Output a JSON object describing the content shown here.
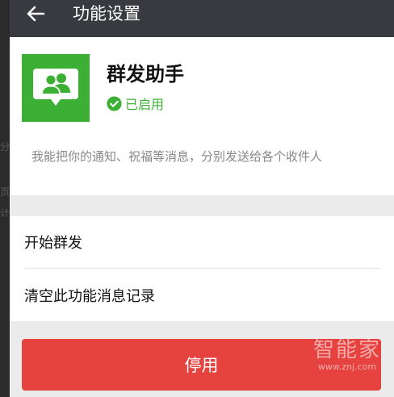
{
  "header": {
    "back_icon": "back-arrow-icon",
    "title": "功能设置"
  },
  "feature": {
    "icon": "group-people-chat-icon",
    "icon_color": "#3cb034",
    "name": "群发助手",
    "status_icon": "check-circle-icon",
    "status": "已启用",
    "description": "我能把你的通知、祝福等消息，分别发送给各个收件人"
  },
  "actions": {
    "start_group_send": "开始群发",
    "clear_records": "清空此功能消息记录"
  },
  "stop_button": {
    "label": "停用",
    "color": "#e64340"
  },
  "watermark": {
    "brand": "智能家",
    "url": "www.znj.com"
  },
  "background_fragments": [
    "分",
    "页",
    "计"
  ]
}
